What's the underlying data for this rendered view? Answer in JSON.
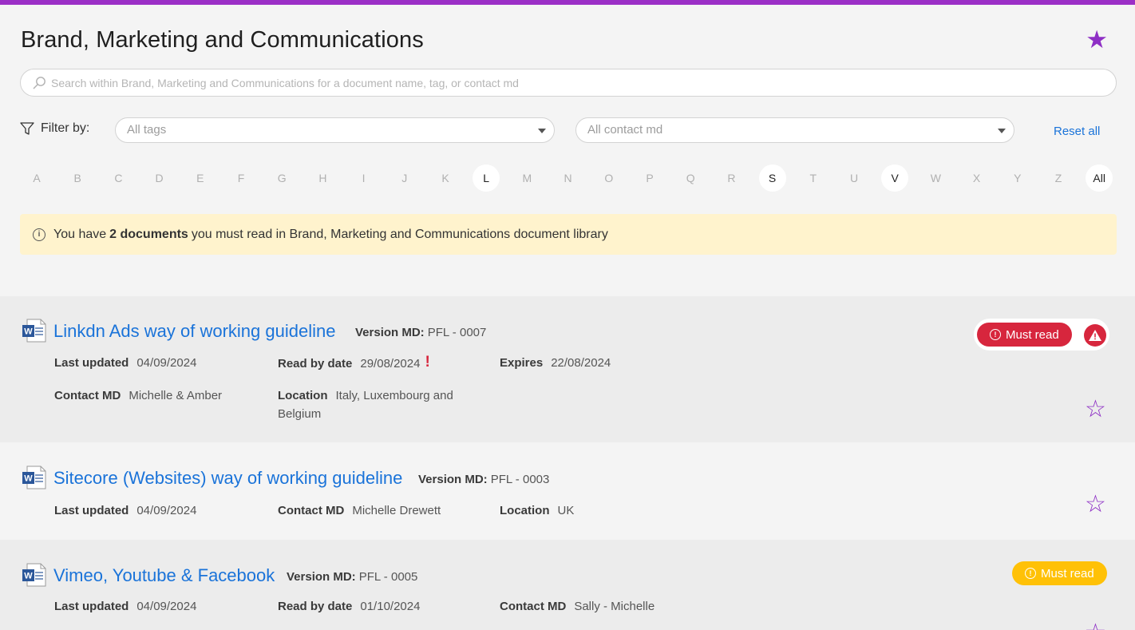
{
  "header": {
    "title": "Brand, Marketing and Communications",
    "favorite_icon": "star-filled-icon"
  },
  "search": {
    "value": "",
    "placeholder": "Search within Brand, Marketing and Communications for a document name, tag, or contact md"
  },
  "filters": {
    "label": "Filter by:",
    "tags_value": "All tags",
    "contact_value": "All contact md",
    "reset_label": "Reset all"
  },
  "alphabet": {
    "letters": [
      "A",
      "B",
      "C",
      "D",
      "E",
      "F",
      "G",
      "H",
      "I",
      "J",
      "K",
      "L",
      "M",
      "N",
      "O",
      "P",
      "Q",
      "R",
      "S",
      "T",
      "U",
      "V",
      "W",
      "X",
      "Y",
      "Z",
      "All"
    ],
    "active": [
      "L",
      "S",
      "V",
      "All"
    ]
  },
  "notice": {
    "prefix": "You have",
    "bold": "2 documents",
    "suffix": "you must read in Brand, Marketing and Communications document library"
  },
  "documents": [
    {
      "title": "Linkdn Ads way of working guideline",
      "version_label": "Version MD:",
      "version": "PFL - 0007",
      "last_updated_label": "Last updated",
      "last_updated": "04/09/2024",
      "read_by_label": "Read by date",
      "read_by": "29/08/2024",
      "overdue_mark": "!",
      "expires_label": "Expires",
      "expires": "22/08/2024",
      "contact_label": "Contact MD",
      "contact": "Michelle & Amber",
      "location_label": "Location",
      "location": "Italy, Luxembourg and Belgium",
      "must_read_label": "Must read"
    },
    {
      "title": "Sitecore (Websites) way of working guideline",
      "version_label": "Version MD:",
      "version": "PFL - 0003",
      "last_updated_label": "Last updated",
      "last_updated": "04/09/2024",
      "contact_label": "Contact MD",
      "contact": "Michelle Drewett",
      "location_label": "Location",
      "location": "UK"
    },
    {
      "title": "Vimeo, Youtube & Facebook",
      "version_label": "Version MD:",
      "version": "PFL - 0005",
      "last_updated_label": "Last updated",
      "last_updated": "04/09/2024",
      "read_by_label": "Read by date",
      "read_by": "01/10/2024",
      "contact_label": "Contact MD",
      "contact": "Sally - Michelle",
      "must_read_label": "Must read"
    }
  ],
  "colors": {
    "accent": "#9b2fc6",
    "link": "#1a73d9",
    "danger": "#d7263d",
    "warning": "#ffc107",
    "notice_bg": "#fff3cd"
  }
}
